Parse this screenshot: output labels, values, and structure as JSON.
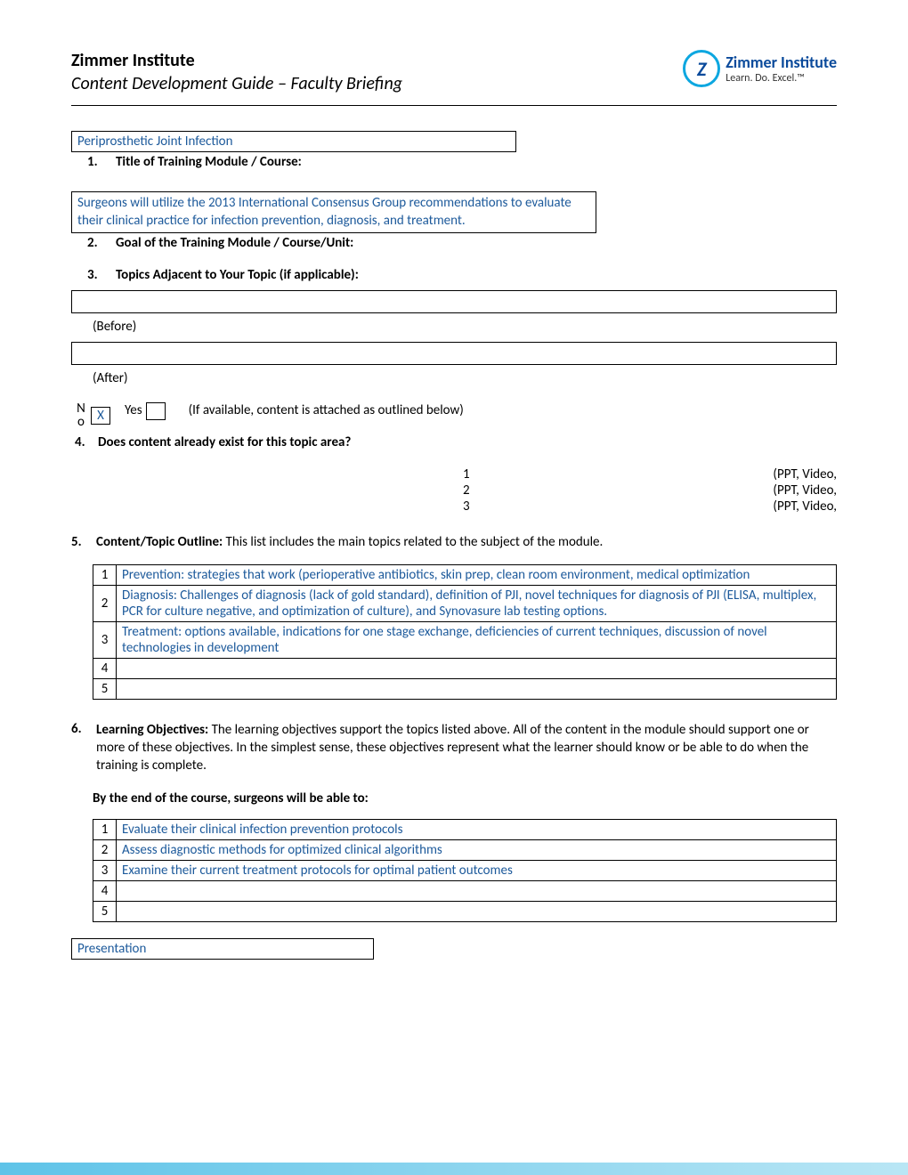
{
  "header": {
    "title": "Zimmer Institute",
    "subtitle": "Content Development Guide – Faculty Briefing",
    "logo_name": "Zimmer Institute",
    "logo_tagline": "Learn. Do. Excel.™",
    "logo_letter": "Z"
  },
  "q1": {
    "num": "1.",
    "label": "Title of Training Module / Course:",
    "value": "Periprosthetic Joint Infection"
  },
  "q2": {
    "num": "2.",
    "label": "Goal of the Training Module / Course/Unit:",
    "value": "Surgeons will utilize the 2013 International Consensus Group recommendations to evaluate their clinical practice for infection prevention, diagnosis, and treatment."
  },
  "q3": {
    "num": "3.",
    "label": "Topics Adjacent to Your Topic (if applicable):",
    "before": "(Before)",
    "after": "(After)"
  },
  "q4": {
    "num": "4.",
    "label": "Does content already exist for this topic area?",
    "no_label": "No",
    "no_value": "X",
    "yes_label": "Yes",
    "yes_value": "",
    "note": "(If available, content is attached as outlined below)",
    "rows": [
      {
        "n": "1",
        "fmt": "(PPT, Video,"
      },
      {
        "n": "2",
        "fmt": "(PPT, Video,"
      },
      {
        "n": "3",
        "fmt": "(PPT, Video,"
      }
    ]
  },
  "q5": {
    "num": "5.",
    "label": "Content/Topic Outline:",
    "desc": "  This list includes the main topics related to the subject of the module.",
    "rows": [
      "Prevention: strategies that work (perioperative antibiotics, skin prep, clean room environment, medical optimization",
      "Diagnosis: Challenges of diagnosis (lack of gold standard), definition of PJI, novel techniques  for diagnosis of PJI (ELISA, multiplex, PCR for culture negative, and optimization of culture), and Synovasure lab testing options.",
      "Treatment: options available, indications for one stage exchange, deficiencies of current techniques, discussion of novel technologies in development",
      "",
      ""
    ]
  },
  "q6": {
    "num": "6.",
    "label": "Learning Objectives:",
    "desc": "  The learning objectives support the topics listed above.  All of the content in the module should support one or more of these objectives.  In the simplest sense, these objectives represent what the learner should know or be able to do when the training is complete.",
    "intro": "By the end of the course, surgeons will be able to:",
    "rows": [
      "Evaluate their clinical infection prevention protocols",
      "Assess diagnostic methods for optimized clinical algorithms",
      "Examine their current treatment protocols for optimal patient outcomes",
      "",
      ""
    ]
  },
  "bottom_box": "Presentation"
}
